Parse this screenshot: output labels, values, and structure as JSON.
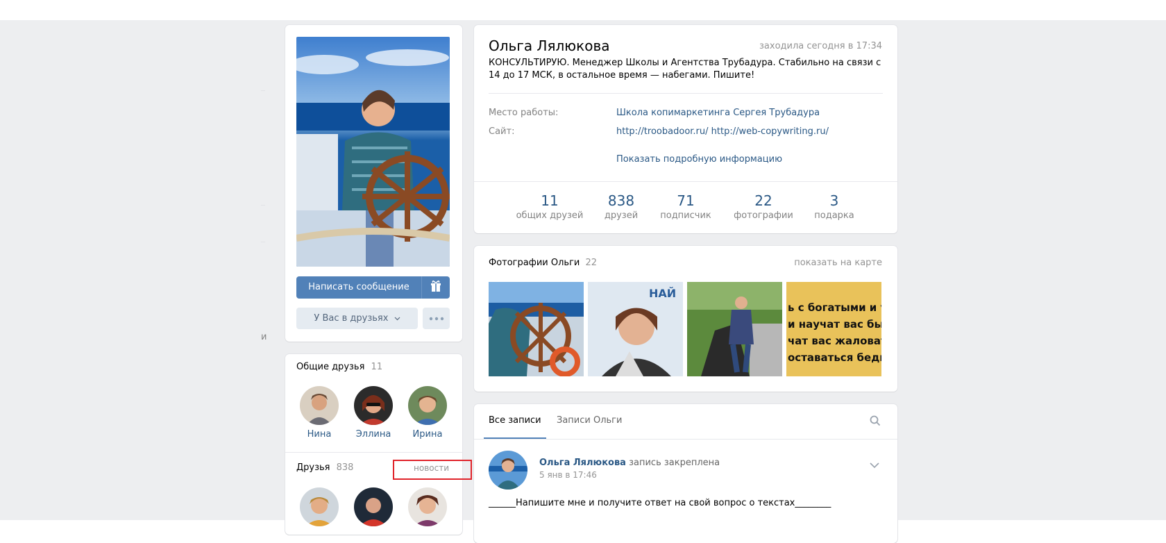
{
  "profile": {
    "name": "Ольга Лялюкова",
    "last_seen": "заходила сегодня в 17:34",
    "status": "КОНСУЛЬТИРУЮ. Менеджер Школы и Агентства Трубадура. Стабильно на связи с 14 до 17 МСК, в остальное время — набегами. Пишите!",
    "info": [
      {
        "label": "Место работы:",
        "value": "Школа копимаркетинга Сергея Трубадура"
      },
      {
        "label": "Сайт:",
        "value": "http://troobadoor.ru/ http://web-copywriting.ru/"
      }
    ],
    "show_more": "Показать подробную информацию",
    "counters": [
      {
        "num": "11",
        "caption": "общих друзей"
      },
      {
        "num": "838",
        "caption": "друзей"
      },
      {
        "num": "71",
        "caption": "подписчик"
      },
      {
        "num": "22",
        "caption": "фотографии"
      },
      {
        "num": "3",
        "caption": "подарка"
      }
    ]
  },
  "actions": {
    "write_message": "Написать сообщение",
    "gift_icon": "gift-icon",
    "friends_status": "У Вас в друзьях",
    "more_icon": "more-dots-icon"
  },
  "left_partial": {
    "letter": "и"
  },
  "common_friends": {
    "title": "Общие друзья",
    "count": "11",
    "people": [
      "Нина",
      "Эллина",
      "Ирина"
    ]
  },
  "friends": {
    "title": "Друзья",
    "count": "838",
    "news_link": "новости"
  },
  "photos": {
    "title": "Фотографии Ольги",
    "count": "22",
    "map_link": "показать на карте",
    "tile4_text": [
      "ь с богатыми и у",
      "и научат вас быт",
      "чат вас жаловать",
      "оставаться бедны"
    ]
  },
  "wall": {
    "tabs": [
      "Все записи",
      "Записи Ольги"
    ],
    "search_icon": "search-icon",
    "post": {
      "author": "Ольга Лялюкова",
      "pinned": "запись закреплена",
      "date": "5 янв в 17:46",
      "text": "______Напишите мне и получите ответ на свой вопрос о текстах________"
    }
  },
  "colors": {
    "accent": "#5181b8",
    "link": "#2a5885",
    "background": "#edeef0",
    "highlight": "#e0232a"
  }
}
